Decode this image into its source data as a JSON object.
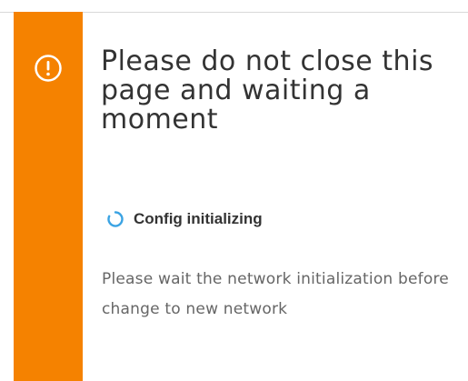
{
  "dialog": {
    "title": "Please do not close this page and waiting a moment",
    "status": {
      "icon": "loading-spinner-icon",
      "text": "Config initializing"
    },
    "message": "Please wait the network initialization before change to new network",
    "alert_icon": "exclamation-circle-icon"
  },
  "colors": {
    "accent": "#f58200",
    "spinner": "#3aa3e3",
    "title_text": "#333333",
    "body_text": "#666666"
  }
}
